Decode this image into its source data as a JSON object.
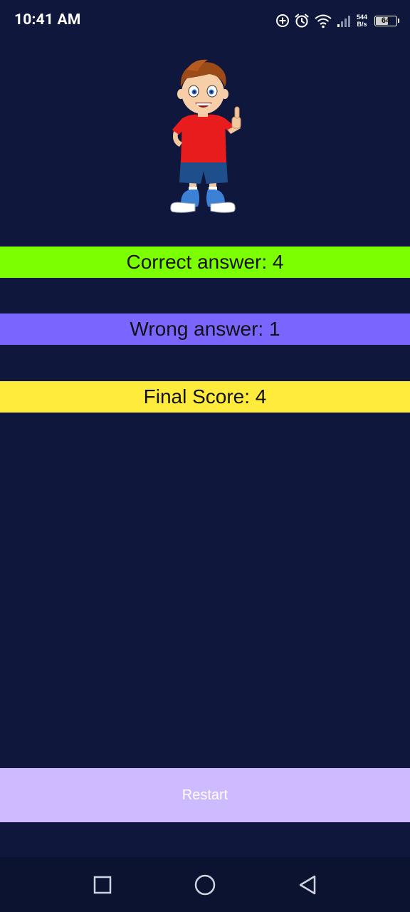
{
  "status_bar": {
    "time": "10:41 AM",
    "net_speed_value": "544",
    "net_speed_unit": "B/s",
    "battery_level": "64",
    "icons": [
      "data-saver-icon",
      "alarm-icon",
      "wifi-icon",
      "signal-icon",
      "battery-icon"
    ]
  },
  "mascot": {
    "icon": "boy-thumbs-up-illustration"
  },
  "results": {
    "correct_label": "Correct answer: 4",
    "wrong_label": "Wrong answer: 1",
    "final_label": "Final Score: 4",
    "colors": {
      "correct": "#7cff00",
      "wrong": "#7a66ff",
      "final": "#ffeb3b"
    }
  },
  "restart": {
    "label": "Restart",
    "color": "#cebafe"
  },
  "navigation": {
    "icons": [
      "recents-square-icon",
      "home-circle-icon",
      "back-triangle-icon"
    ]
  },
  "theme": {
    "background": "#10173d",
    "navbar_background": "#0c1330"
  }
}
